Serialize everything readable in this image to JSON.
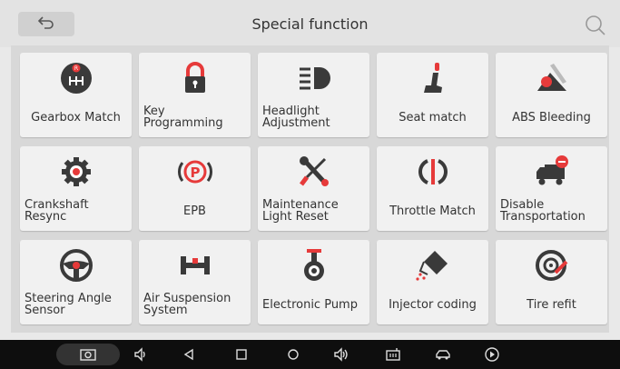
{
  "header": {
    "title": "Special function",
    "back_icon": "back-arrow-icon",
    "search_icon": "search-icon"
  },
  "tiles": [
    {
      "label": "Gearbox Match",
      "icon": "gear-shift-icon",
      "accent": "#e63a3a"
    },
    {
      "label": "Key Programming",
      "icon": "padlock-icon",
      "accent": "#e63a3a"
    },
    {
      "label": "Headlight Adjustment",
      "icon": "headlight-icon",
      "accent": "#e63a3a"
    },
    {
      "label": "Seat match",
      "icon": "car-seat-icon",
      "accent": "#e63a3a"
    },
    {
      "label": "ABS Bleeding",
      "icon": "abs-bleeding-icon",
      "accent": "#e63a3a"
    },
    {
      "label": "Crankshaft Resync",
      "icon": "crankshaft-gear-icon",
      "accent": "#e63a3a"
    },
    {
      "label": "EPB",
      "icon": "parking-brake-icon",
      "accent": "#e63a3a"
    },
    {
      "label": "Maintenance Light Reset",
      "icon": "wrench-screwdriver-icon",
      "accent": "#e63a3a"
    },
    {
      "label": "Throttle Match",
      "icon": "throttle-icon",
      "accent": "#e63a3a"
    },
    {
      "label": "Disable Transportation",
      "icon": "truck-disable-icon",
      "accent": "#e63a3a"
    },
    {
      "label": "Steering Angle Sensor",
      "icon": "steering-wheel-icon",
      "accent": "#e63a3a"
    },
    {
      "label": "Air Suspension System",
      "icon": "axle-icon",
      "accent": "#e63a3a"
    },
    {
      "label": "Electronic Pump",
      "icon": "pump-icon",
      "accent": "#e63a3a"
    },
    {
      "label": "Injector coding",
      "icon": "injector-icon",
      "accent": "#e63a3a"
    },
    {
      "label": "Tire refit",
      "icon": "tire-icon",
      "accent": "#e63a3a"
    }
  ],
  "navbar": {
    "icons": [
      "screenshot-icon",
      "volume-down-icon",
      "back-icon",
      "recent-apps-icon",
      "home-icon",
      "volume-up-icon",
      "vci-icon",
      "car-connect-icon",
      "play-icon"
    ]
  },
  "colors": {
    "icon_dark": "#3a3a3a",
    "accent_red": "#e63a3a",
    "navbar_bg": "#0e0e0e"
  }
}
